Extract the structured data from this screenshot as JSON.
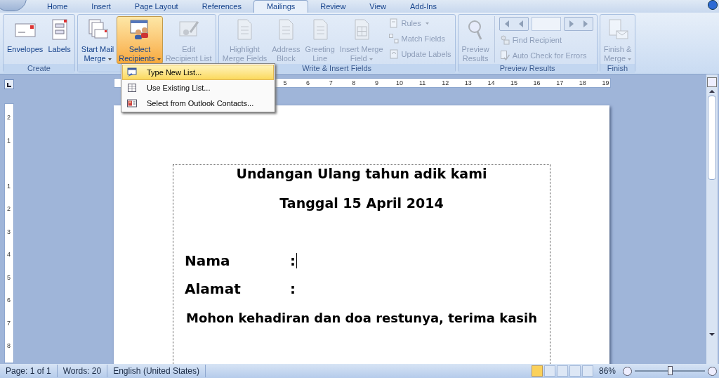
{
  "tabs": [
    {
      "label": "Home",
      "selected": false
    },
    {
      "label": "Insert",
      "selected": false
    },
    {
      "label": "Page Layout",
      "selected": false
    },
    {
      "label": "References",
      "selected": false
    },
    {
      "label": "Mailings",
      "selected": true
    },
    {
      "label": "Review",
      "selected": false
    },
    {
      "label": "View",
      "selected": false
    },
    {
      "label": "Add-Ins",
      "selected": false
    }
  ],
  "ribbon_groups": [
    {
      "title": "Create",
      "items": [
        {
          "kind": "large",
          "lines": [
            "Envelopes"
          ],
          "dropdown": false,
          "disabled": false,
          "open": false
        },
        {
          "kind": "large",
          "lines": [
            "Labels"
          ],
          "dropdown": false,
          "disabled": false,
          "open": false
        }
      ]
    },
    {
      "items": [
        {
          "kind": "large",
          "lines": [
            "Start Mail",
            "Merge"
          ],
          "dropdown": true,
          "disabled": false,
          "open": false
        },
        {
          "kind": "large",
          "lines": [
            "Select",
            "Recipients"
          ],
          "dropdown": true,
          "disabled": false,
          "open": true
        },
        {
          "kind": "large",
          "lines": [
            "Edit",
            "Recipient List"
          ],
          "dropdown": false,
          "disabled": true,
          "open": false
        }
      ]
    },
    {
      "title": "Write & Insert Fields",
      "items": [
        {
          "kind": "large",
          "lines": [
            "Highlight",
            "Merge Fields"
          ],
          "dropdown": false,
          "disabled": true,
          "open": false
        },
        {
          "kind": "large",
          "lines": [
            "Address",
            "Block"
          ],
          "dropdown": false,
          "disabled": true,
          "open": false
        },
        {
          "kind": "large",
          "lines": [
            "Greeting",
            "Line"
          ],
          "dropdown": false,
          "disabled": true,
          "open": false
        },
        {
          "kind": "large",
          "lines": [
            "Insert Merge",
            "Field"
          ],
          "dropdown": true,
          "disabled": true,
          "open": false
        },
        {
          "kind": "stack",
          "rows": [
            {
              "label": "Rules",
              "dropdown": true,
              "disabled": true
            },
            {
              "label": "Match Fields",
              "dropdown": false,
              "disabled": true
            },
            {
              "label": "Update Labels",
              "dropdown": false,
              "disabled": true
            }
          ]
        }
      ]
    },
    {
      "title": "Preview Results",
      "items": [
        {
          "kind": "large",
          "lines": [
            "Preview",
            "Results"
          ],
          "dropdown": false,
          "disabled": true,
          "open": false
        },
        {
          "kind": "nav",
          "rows": [
            {
              "label": "Find Recipient",
              "dropdown": false,
              "disabled": true
            },
            {
              "label": "Auto Check for Errors",
              "dropdown": false,
              "disabled": true
            }
          ]
        }
      ]
    },
    {
      "title": "Finish",
      "items": [
        {
          "kind": "large",
          "lines": [
            "Finish &",
            "Merge"
          ],
          "dropdown": true,
          "disabled": true,
          "open": false
        }
      ]
    }
  ],
  "menu": [
    {
      "label": "Type New List...",
      "selected": true
    },
    {
      "label": "Use Existing List...",
      "selected": false
    },
    {
      "label": "Select from Outlook Contacts...",
      "selected": false
    }
  ],
  "ruler_numbers": [
    "5",
    "6",
    "7",
    "8",
    "9",
    "10",
    "11",
    "12",
    "13",
    "14",
    "15",
    "16",
    "17",
    "18",
    "19"
  ],
  "vertical_ruler_numbers": [
    "2",
    "1",
    "1",
    "2",
    "3",
    "4",
    "5",
    "6",
    "7",
    "8"
  ],
  "document": {
    "title": "Undangan Ulang tahun adik kami",
    "date": "Tanggal 15 April 2014",
    "fields": [
      {
        "label": "Nama",
        "colon": ":",
        "cursor": true
      },
      {
        "label": "Alamat",
        "colon": ":",
        "cursor": false
      }
    ],
    "closing": "Mohon kehadiran dan doa restunya, terima kasih"
  },
  "status_bar": {
    "page": "Page: 1 of 1",
    "words": "Words: 20",
    "language": "English (United States)",
    "zoom": "86%",
    "views": [
      {
        "selected": true
      },
      {
        "selected": false
      },
      {
        "selected": false
      },
      {
        "selected": false
      },
      {
        "selected": false
      }
    ],
    "zoom_slider": {
      "level": 0.5
    }
  }
}
